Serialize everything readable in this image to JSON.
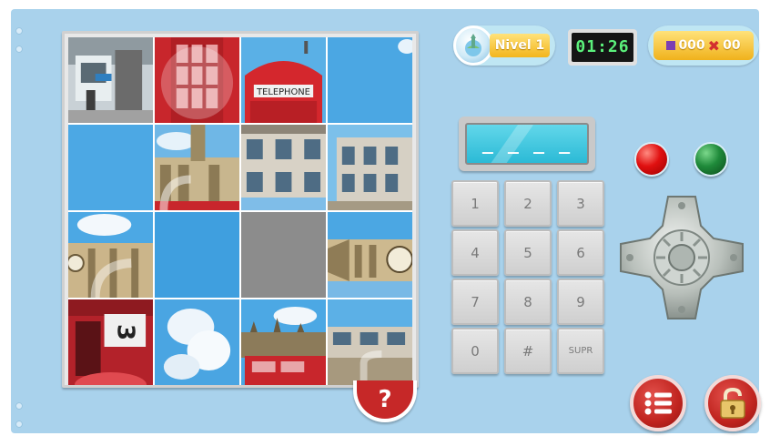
{
  "hud": {
    "level_label": "Nivel 1",
    "level_icon": "statue-of-liberty-globe-icon",
    "timer": "01:26",
    "score_correct": "000",
    "score_wrong": "00"
  },
  "code_display": {
    "value": "_ _ _ _"
  },
  "keypad": {
    "keys": [
      "1",
      "2",
      "3",
      "4",
      "5",
      "6",
      "7",
      "8",
      "9",
      "0",
      "#",
      "SUPR"
    ]
  },
  "help": {
    "label": "?"
  },
  "colors": {
    "background": "#a9d2ec",
    "accent_red": "#c62828",
    "light_red": "#e01010",
    "light_green": "#1f8a3a",
    "gold": "#f3b51c",
    "timer_digits": "#5bf07b",
    "empty_slot": "#8c8c8c"
  },
  "puzzle": {
    "grid": "4x4",
    "theme": "London",
    "tiles": [
      "bus-stop-street",
      "red-phone-box-window",
      "telephone-box-sign",
      "sky",
      "sky",
      "big-ben-tower-base",
      "building-facade-upside-down",
      "building-facade-upside-down",
      "sky-with-clouds",
      "sky",
      "empty",
      "big-ben-clock-rotated",
      "red-bus-number",
      "clouds",
      "houses-of-parliament-bus",
      "building-facade-rotated"
    ],
    "tile_texts": {
      "telephone_sign": "TELEPHONE"
    }
  },
  "icons": {
    "menu": "list-menu-icon",
    "lock": "padlock-icon",
    "dpad": "direction-pad-icon"
  }
}
